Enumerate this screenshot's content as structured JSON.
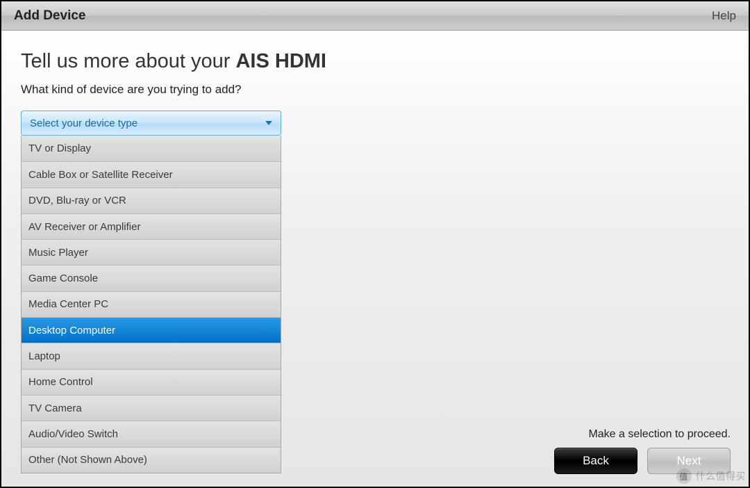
{
  "titlebar": {
    "title": "Add Device",
    "help": "Help"
  },
  "heading": {
    "prefix": "Tell us more about your ",
    "bold": "AIS HDMI"
  },
  "subtitle": "What kind of device are you trying to add?",
  "combo": {
    "placeholder": "Select your device type"
  },
  "options": [
    "TV or Display",
    "Cable Box or Satellite Receiver",
    "DVD, Blu-ray or VCR",
    "AV Receiver or Amplifier",
    "Music Player",
    "Game Console",
    "Media Center PC",
    "Desktop Computer",
    "Laptop",
    "Home Control",
    "TV Camera",
    "Audio/Video Switch",
    "Other (Not Shown Above)"
  ],
  "hover_index": 7,
  "footer": {
    "hint": "Make a selection to proceed.",
    "back": "Back",
    "next": "Next"
  },
  "watermark": "什么值得买"
}
